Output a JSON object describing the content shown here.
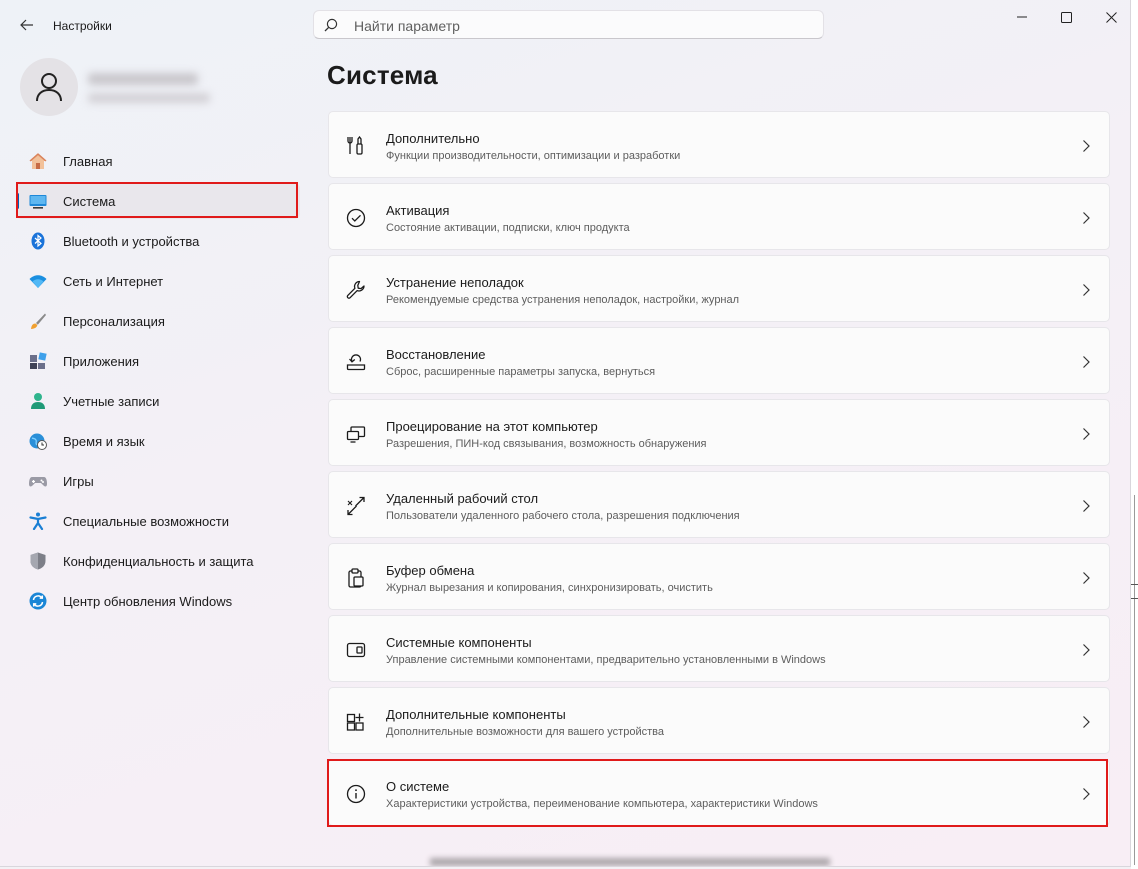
{
  "window": {
    "title": "Настройки"
  },
  "search": {
    "placeholder": "Найти параметр",
    "value": ""
  },
  "sidebar": {
    "items": [
      {
        "label": "Главная",
        "icon": "home-icon",
        "active": false
      },
      {
        "label": "Система",
        "icon": "system-display-icon",
        "active": true
      },
      {
        "label": "Bluetooth и устройства",
        "icon": "bluetooth-icon",
        "active": false
      },
      {
        "label": "Сеть и Интернет",
        "icon": "wifi-icon",
        "active": false
      },
      {
        "label": "Персонализация",
        "icon": "brush-icon",
        "active": false
      },
      {
        "label": "Приложения",
        "icon": "apps-icon",
        "active": false
      },
      {
        "label": "Учетные записи",
        "icon": "account-icon",
        "active": false
      },
      {
        "label": "Время и язык",
        "icon": "globe-clock-icon",
        "active": false
      },
      {
        "label": "Игры",
        "icon": "gamepad-icon",
        "active": false
      },
      {
        "label": "Специальные возможности",
        "icon": "accessibility-icon",
        "active": false
      },
      {
        "label": "Конфиденциальность и защита",
        "icon": "shield-icon",
        "active": false
      },
      {
        "label": "Центр обновления Windows",
        "icon": "update-icon",
        "active": false
      }
    ]
  },
  "main": {
    "title": "Система",
    "cards": [
      {
        "title": "Дополнительно",
        "subtitle": "Функции производительности, оптимизации и разработки",
        "icon": "tools-icon"
      },
      {
        "title": "Активация",
        "subtitle": "Состояние активации, подписки, ключ продукта",
        "icon": "check-circle-icon"
      },
      {
        "title": "Устранение неполадок",
        "subtitle": "Рекомендуемые средства устранения неполадок, настройки, журнал",
        "icon": "wrench-icon"
      },
      {
        "title": "Восстановление",
        "subtitle": "Сброс, расширенные параметры запуска, вернуться",
        "icon": "recovery-icon"
      },
      {
        "title": "Проецирование на этот компьютер",
        "subtitle": "Разрешения, ПИН-код связывания, возможность обнаружения",
        "icon": "projection-icon"
      },
      {
        "title": "Удаленный рабочий стол",
        "subtitle": "Пользователи удаленного рабочего стола, разрешения подключения",
        "icon": "remote-desktop-icon"
      },
      {
        "title": "Буфер обмена",
        "subtitle": "Журнал вырезания и копирования, синхронизировать, очистить",
        "icon": "clipboard-icon"
      },
      {
        "title": "Системные компоненты",
        "subtitle": "Управление системными компонентами, предварительно установленными в Windows",
        "icon": "system-components-icon"
      },
      {
        "title": "Дополнительные компоненты",
        "subtitle": "Дополнительные возможности для вашего устройства",
        "icon": "optional-features-icon"
      },
      {
        "title": "О системе",
        "subtitle": "Характеристики устройства, переименование компьютера, характеристики Windows",
        "icon": "info-icon"
      }
    ]
  },
  "colors": {
    "accent": "#005fb8",
    "highlight": "#e01a1a"
  }
}
